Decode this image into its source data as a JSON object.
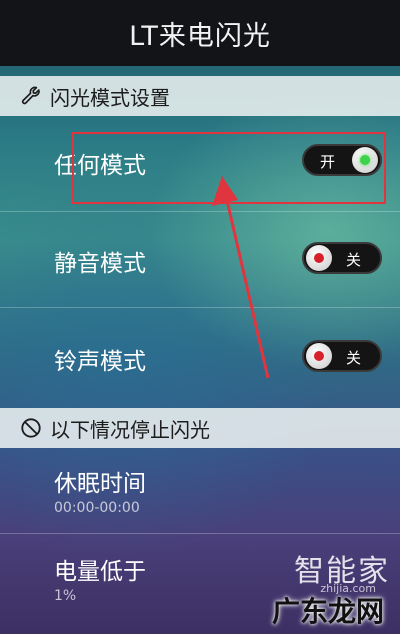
{
  "header": {
    "title": "LT来电闪光"
  },
  "flash_mode_section": {
    "title": "闪光模式设置",
    "items": [
      {
        "label": "任何模式",
        "toggle_text": "开",
        "state": "on"
      },
      {
        "label": "静音模式",
        "toggle_text": "关",
        "state": "off"
      },
      {
        "label": "铃声模式",
        "toggle_text": "关",
        "state": "off"
      }
    ]
  },
  "stop_section": {
    "title": "以下情况停止闪光",
    "items": [
      {
        "label": "休眠时间",
        "value": "00:00-00:00"
      },
      {
        "label": "电量低于",
        "value": "1%"
      }
    ]
  },
  "watermark": {
    "logo": "智能家",
    "url": "zhijia.com",
    "site": "广东龙网"
  },
  "colors": {
    "header_bg": "#131418",
    "toggle_on": "#3ed34a",
    "toggle_off": "#d8202a",
    "annotation": "#e0353e"
  }
}
